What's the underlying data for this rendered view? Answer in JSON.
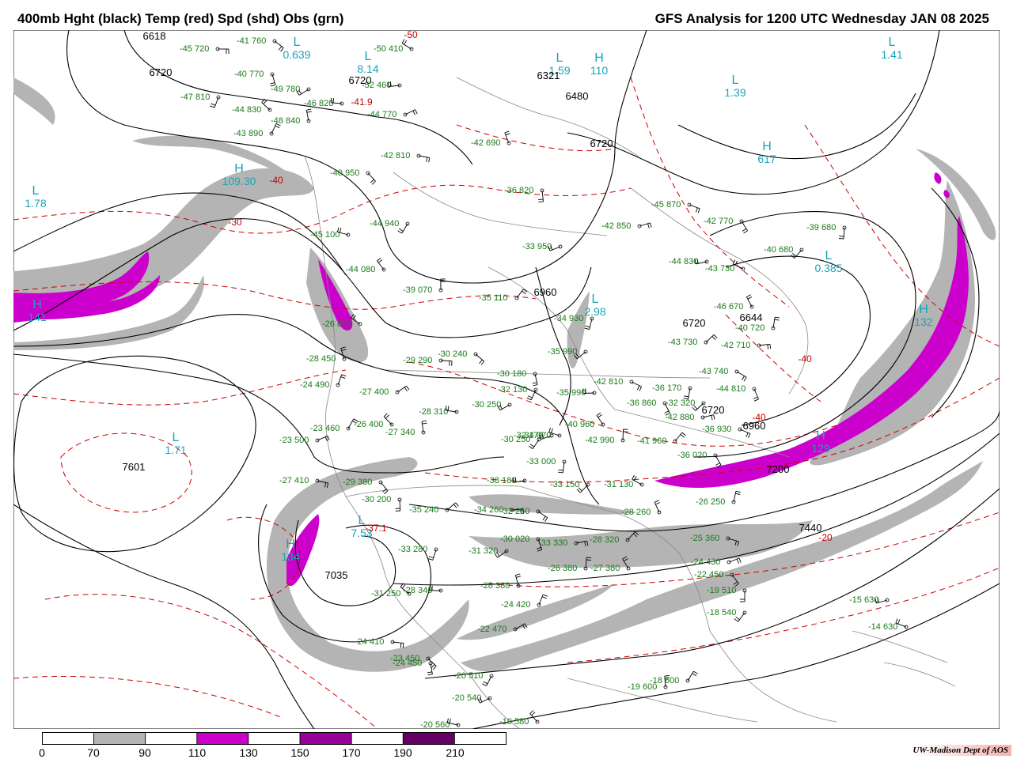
{
  "header": {
    "left_title": "400mb Hght (black) Temp (red) Spd (shd) Obs (grn)",
    "right_title": "GFS Analysis for 1200 UTC Wednesday  JAN 08 2025"
  },
  "colors": {
    "height_contour": "#000000",
    "temp_contour": "#cc0000",
    "geography": "#888888",
    "obs": "#1a7a1a",
    "speed_label": "#1aa3b8",
    "shade_70": "#b4b4b4",
    "shade_110": "#cc00cc",
    "shade_150": "#990099",
    "shade_190": "#660066"
  },
  "colorbar": {
    "labels": [
      "0",
      "70",
      "90",
      "110",
      "130",
      "150",
      "170",
      "190",
      "210"
    ],
    "fills": [
      "#ffffff",
      "#b4b4b4",
      "#ffffff",
      "#cc00cc",
      "#ffffff",
      "#990099",
      "#ffffff",
      "#660066",
      "#ffffff"
    ]
  },
  "height_labels": [
    "6618",
    "6720",
    "6720",
    "6321",
    "6480",
    "6720",
    "6960",
    "6720",
    "6644",
    "6960",
    "6720",
    "7200",
    "7440",
    "7601",
    "7035"
  ],
  "temp_labels": [
    "-50",
    "-41.9",
    "-40",
    "-30",
    "-37.1",
    "-40",
    "-40",
    "-20"
  ],
  "speed_centers": [
    {
      "letter": "L",
      "value": "1.78"
    },
    {
      "letter": "H",
      "value": "109.30"
    },
    {
      "letter": "H",
      "value": "141"
    },
    {
      "letter": "L",
      "value": "8.14"
    },
    {
      "letter": "L",
      "value": "0.639"
    },
    {
      "letter": "L",
      "value": "1.59"
    },
    {
      "letter": "H",
      "value": "110"
    },
    {
      "letter": "L",
      "value": "1.39"
    },
    {
      "letter": "L",
      "value": "1.41"
    },
    {
      "letter": "H",
      "value": "617"
    },
    {
      "letter": "L",
      "value": "0.385"
    },
    {
      "letter": "L",
      "value": "2.98"
    },
    {
      "letter": "H",
      "value": "132"
    },
    {
      "letter": "H",
      "value": "129"
    },
    {
      "letter": "L",
      "value": "1.71"
    },
    {
      "letter": "H",
      "value": "134"
    },
    {
      "letter": "L",
      "value": "7.53"
    }
  ],
  "observations": [
    "-45 720",
    "-41 760",
    "-40 770",
    "-47 810",
    "-49 780",
    "-46 820",
    "-44 830",
    "-48 840",
    "-43 890",
    "-44 770",
    "-42 810",
    "-40 950",
    "-36 820",
    "-44 940",
    "-33 950",
    "-45 100",
    "-44 080",
    "-39 070",
    "-35 110",
    "-42 850",
    "-45 870",
    "-42 770",
    "-39 680",
    "-40 680",
    "-44 830",
    "-43 730",
    "-46 670",
    "-40 720",
    "-43 730",
    "-42 710",
    "-43 740",
    "-44 810",
    "-34 930",
    "-35 990",
    "-35 990",
    "-26 870",
    "-28 450",
    "-24 490",
    "-27 400",
    "-29 290",
    "-30 240",
    "-30 180",
    "-32 130",
    "-30 250",
    "-28 310",
    "-26 400",
    "-27 340",
    "-23 460",
    "-23 500",
    "-27 410",
    "-29 380",
    "-30 200",
    "-30 250",
    "-32 170",
    "-34 070",
    "-40 960",
    "-42 990",
    "-41 960",
    "-42 880",
    "-36 930",
    "-36 020",
    "-33 000",
    "-33 150",
    "-38 180",
    "-31 130",
    "-28 260",
    "-26 250",
    "-35 240",
    "-34 260",
    "-32 250",
    "-30 020",
    "-33 280",
    "-31 320",
    "-28 340",
    "-31 250",
    "-28 380",
    "-24 420",
    "-22 470",
    "-24 410",
    "-23 450",
    "-24 450",
    "-20 510",
    "-20 540",
    "-20 560",
    "-19 580",
    "-19 600",
    "-18 600",
    "-24 430",
    "-25 360",
    "-22 450",
    "-19 510",
    "-18 540",
    "-15 630",
    "-14 630",
    "-27 380",
    "-26 380",
    "-28 320",
    "-33 330",
    "-42 810",
    "-36 860",
    "-36 170",
    "-32 320",
    "-52 460",
    "-50 410",
    "-42 690"
  ],
  "credit": "UW-Madison  Dept of AOS"
}
